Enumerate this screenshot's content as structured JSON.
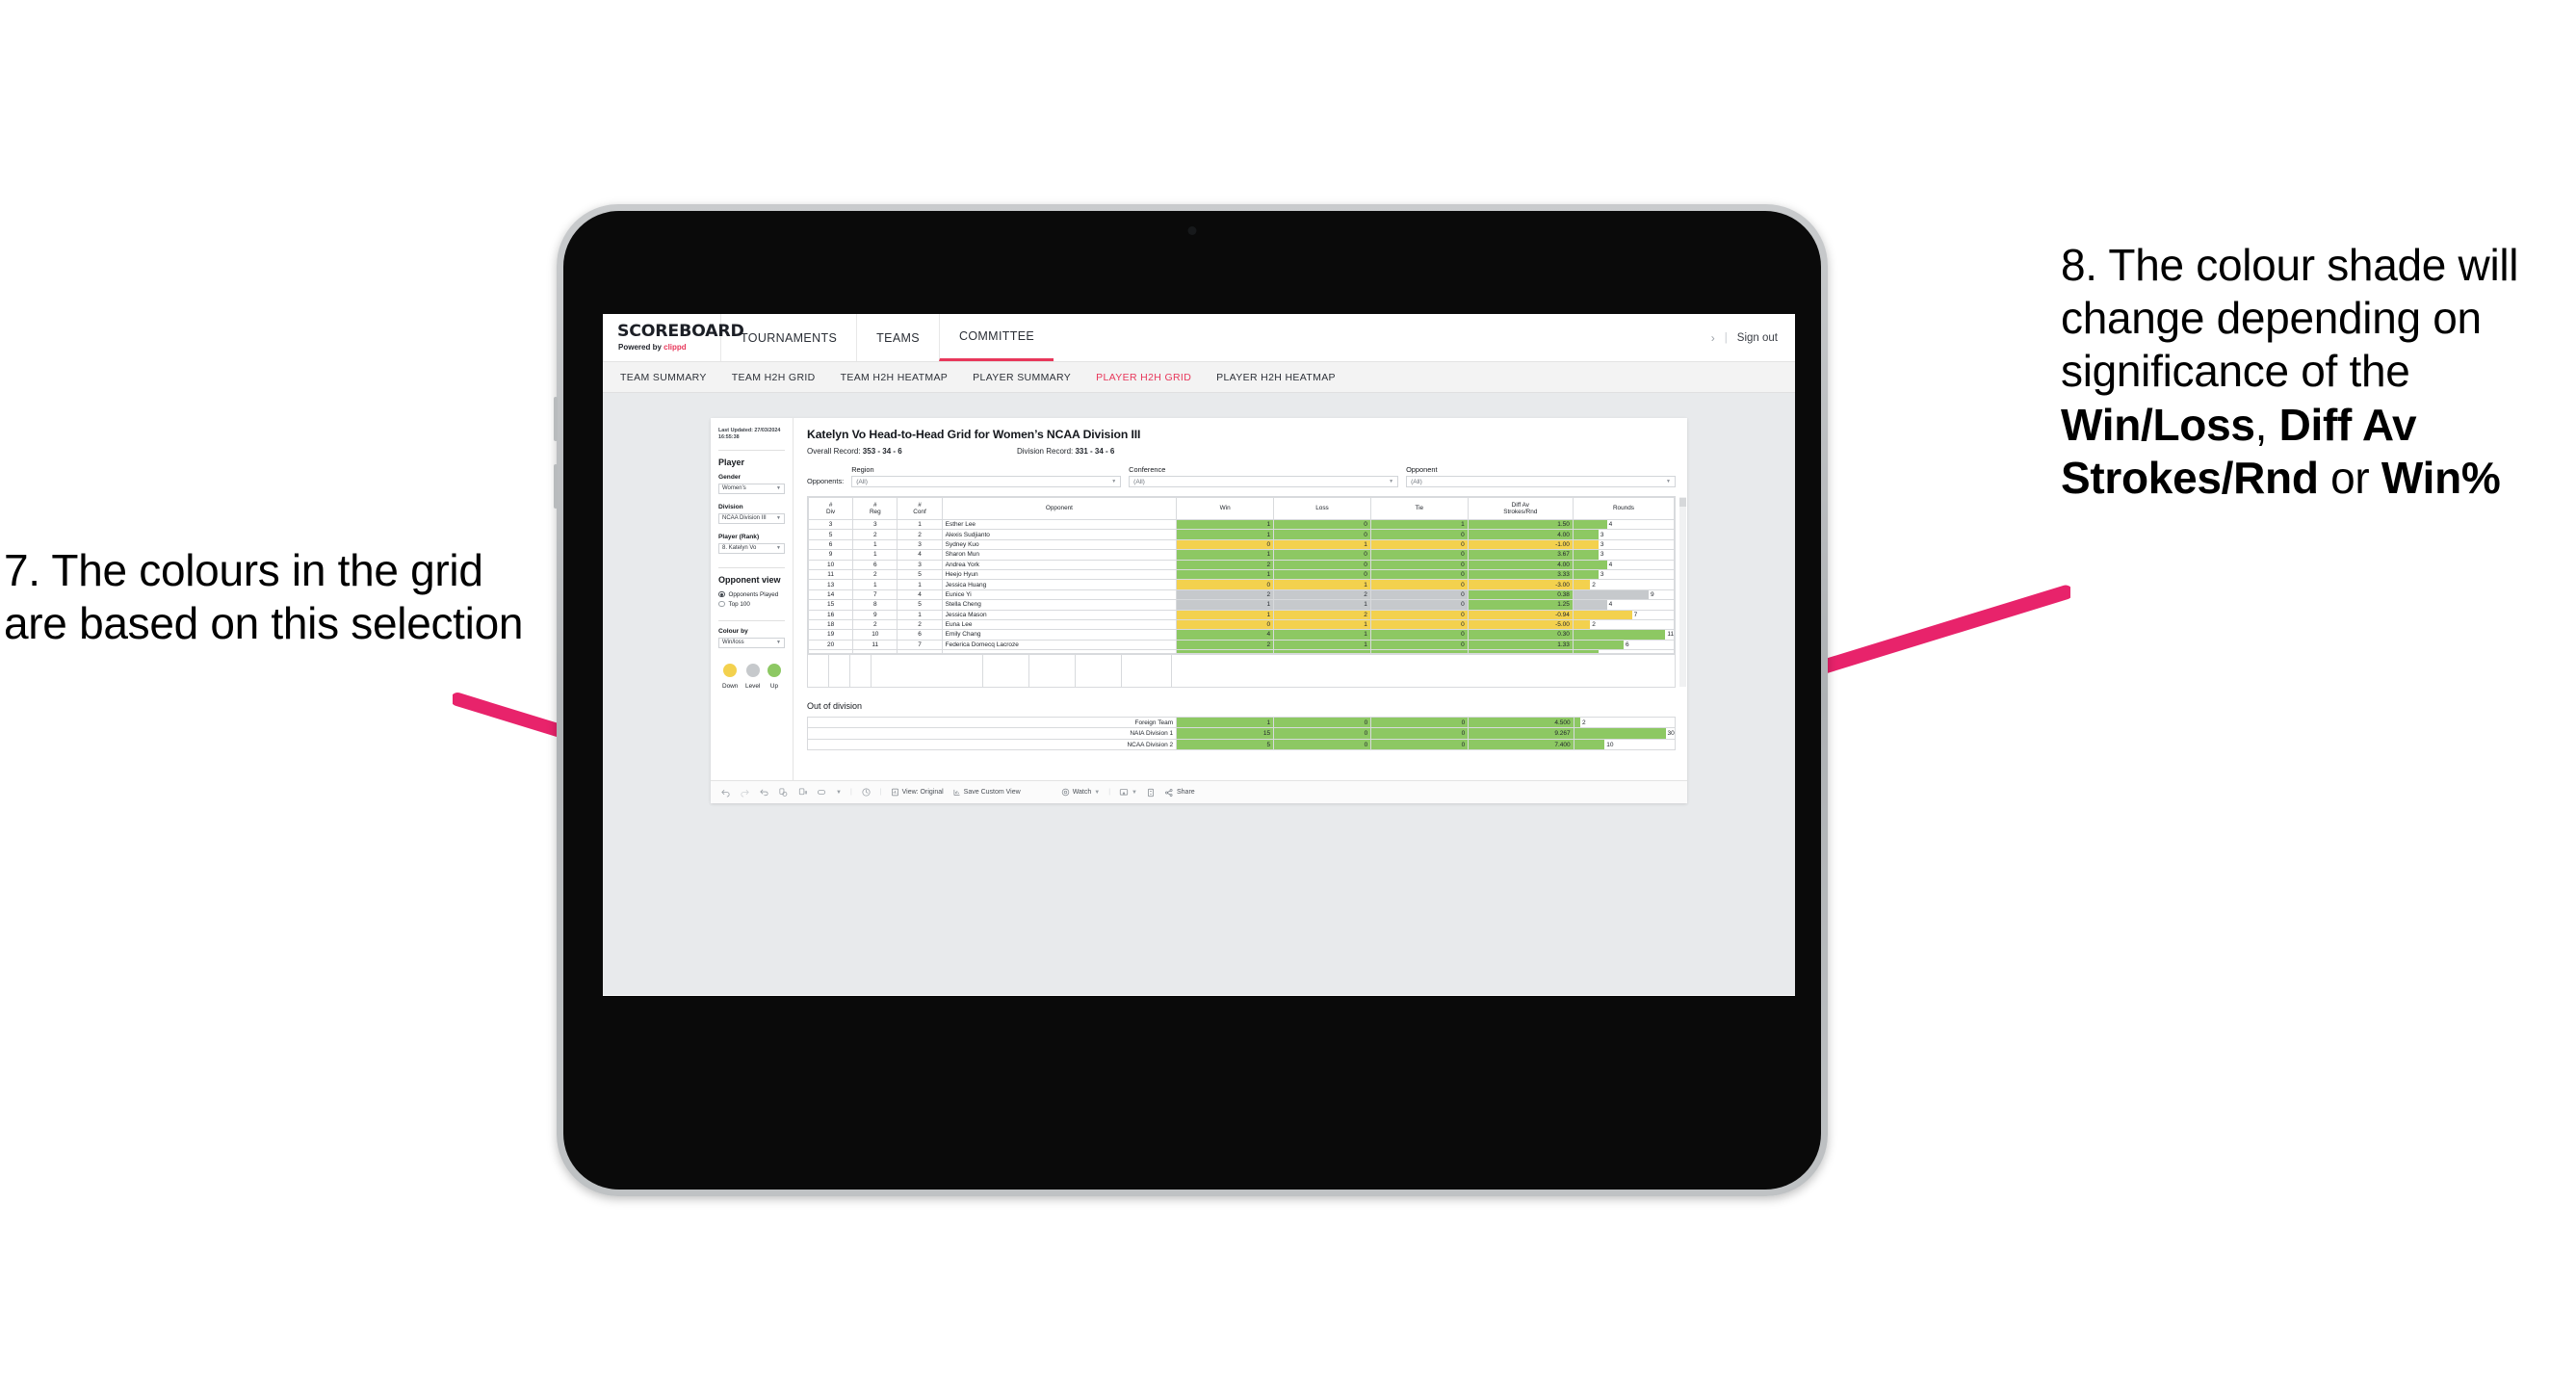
{
  "annotations": {
    "left": "7. The colours in the grid are based on this selection",
    "right_pre": "8. The colour shade will change depending on significance of the ",
    "right_b1": "Win/Loss",
    "right_mid1": ", ",
    "right_b2": "Diff Av Strokes/Rnd",
    "right_mid2": " or ",
    "right_b3": "Win%",
    "arrow_color": "#e8236b"
  },
  "header": {
    "logo_main": "SCOREBOARD",
    "logo_sub_prefix": "Powered by ",
    "logo_sub_brand": "clippd",
    "nav": [
      {
        "label": "TOURNAMENTS",
        "active": false
      },
      {
        "label": "TEAMS",
        "active": false
      },
      {
        "label": "COMMITTEE",
        "active": true
      }
    ],
    "chevron": "›",
    "separator": "|",
    "sign_out": "Sign out"
  },
  "subnav": [
    {
      "label": "TEAM SUMMARY",
      "active": false
    },
    {
      "label": "TEAM H2H GRID",
      "active": false
    },
    {
      "label": "TEAM H2H HEATMAP",
      "active": false
    },
    {
      "label": "PLAYER SUMMARY",
      "active": false
    },
    {
      "label": "PLAYER H2H GRID",
      "active": true
    },
    {
      "label": "PLAYER H2H HEATMAP",
      "active": false
    }
  ],
  "filters": {
    "last_updated": "Last Updated: 27/03/2024 16:55:38",
    "section_title": "Player",
    "gender_label": "Gender",
    "gender_value": "Women’s",
    "division_label": "Division",
    "division_value": "NCAA Division III",
    "player_label": "Player (Rank)",
    "player_value": "8. Katelyn Vo",
    "opponent_view_title": "Opponent view",
    "opponent_view_options": [
      {
        "label": "Opponents Played",
        "selected": true
      },
      {
        "label": "Top 100",
        "selected": false
      }
    ],
    "colour_by_label": "Colour by",
    "colour_by_value": "Win/loss",
    "legend": [
      {
        "label": "Down",
        "color": "#f3d14e"
      },
      {
        "label": "Level",
        "color": "#c6c9cc"
      },
      {
        "label": "Up",
        "color": "#8dc863"
      }
    ]
  },
  "main": {
    "title": "Katelyn Vo Head-to-Head Grid for Women’s NCAA Division III",
    "overall_record_label": "Overall Record: ",
    "overall_record_value": "353 -  34 - 6",
    "division_record_label": "Division Record: ",
    "division_record_value": "331 -  34 - 6",
    "opponents_label": "Opponents:",
    "opponent_filters": [
      {
        "caption": "Region",
        "value": "(All)"
      },
      {
        "caption": "Conference",
        "value": "(All)"
      },
      {
        "caption": "Opponent",
        "value": "(All)"
      }
    ],
    "columns": [
      "# Div",
      "# Reg",
      "# Conf",
      "Opponent",
      "Win",
      "Loss",
      "Tie",
      "Diff Av Strokes/Rnd",
      "Rounds"
    ],
    "column_head_lines": [
      [
        "#",
        "Div"
      ],
      [
        "#",
        "Reg"
      ],
      [
        "#",
        "Conf"
      ],
      [
        "Opponent",
        ""
      ],
      [
        "Win",
        ""
      ],
      [
        "Loss",
        ""
      ],
      [
        "Tie",
        ""
      ],
      [
        "Diff Av",
        "Strokes/Rnd"
      ],
      [
        "Rounds",
        ""
      ]
    ],
    "out_of_division_title": "Out of division"
  },
  "toolbar": {
    "view_label": "View: Original",
    "save_label": "Save Custom View",
    "watch_label": "Watch",
    "share_label": "Share"
  },
  "chart_data": {
    "type": "table",
    "title": "Katelyn Vo Head-to-Head Grid for Women’s NCAA Division III",
    "colors": {
      "up": "#8dc863",
      "down": "#f3d14e",
      "level": "#c6c9cc",
      "none": "#ffffff"
    },
    "rounds_max": 12,
    "columns": [
      "#Div",
      "#Reg",
      "#Conf",
      "Opponent",
      "Win",
      "Loss",
      "Tie",
      "Diff Av Strokes/Rnd",
      "Rounds"
    ],
    "rows": [
      {
        "div": "3",
        "reg": "3",
        "conf": "1",
        "opponent": "Esther Lee",
        "win": "1",
        "loss": "0",
        "tie": "1",
        "diff": "1.50",
        "rounds": "4",
        "rounds_n": 4,
        "color": "up"
      },
      {
        "div": "5",
        "reg": "2",
        "conf": "2",
        "opponent": "Alexis Sudjianto",
        "win": "1",
        "loss": "0",
        "tie": "0",
        "diff": "4.00",
        "rounds": "3",
        "rounds_n": 3,
        "color": "up"
      },
      {
        "div": "6",
        "reg": "1",
        "conf": "3",
        "opponent": "Sydney Kuo",
        "win": "0",
        "loss": "1",
        "tie": "0",
        "diff": "-1.00",
        "rounds": "3",
        "rounds_n": 3,
        "color": "down"
      },
      {
        "div": "9",
        "reg": "1",
        "conf": "4",
        "opponent": "Sharon Mun",
        "win": "1",
        "loss": "0",
        "tie": "0",
        "diff": "3.67",
        "rounds": "3",
        "rounds_n": 3,
        "color": "up"
      },
      {
        "div": "10",
        "reg": "6",
        "conf": "3",
        "opponent": "Andrea York",
        "win": "2",
        "loss": "0",
        "tie": "0",
        "diff": "4.00",
        "rounds": "4",
        "rounds_n": 4,
        "color": "up"
      },
      {
        "div": "11",
        "reg": "2",
        "conf": "5",
        "opponent": "Heejo Hyun",
        "win": "1",
        "loss": "0",
        "tie": "0",
        "diff": "3.33",
        "rounds": "3",
        "rounds_n": 3,
        "color": "up"
      },
      {
        "div": "13",
        "reg": "1",
        "conf": "1",
        "opponent": "Jessica Huang",
        "win": "0",
        "loss": "1",
        "tie": "0",
        "diff": "-3.00",
        "rounds": "2",
        "rounds_n": 2,
        "color": "down"
      },
      {
        "div": "14",
        "reg": "7",
        "conf": "4",
        "opponent": "Eunice Yi",
        "win": "2",
        "loss": "2",
        "tie": "0",
        "diff": "0.38",
        "rounds": "9",
        "rounds_n": 9,
        "color": "level",
        "diff_color": "up"
      },
      {
        "div": "15",
        "reg": "8",
        "conf": "5",
        "opponent": "Stella Cheng",
        "win": "1",
        "loss": "1",
        "tie": "0",
        "diff": "1.25",
        "rounds": "4",
        "rounds_n": 4,
        "color": "level",
        "diff_color": "up"
      },
      {
        "div": "16",
        "reg": "9",
        "conf": "1",
        "opponent": "Jessica Mason",
        "win": "1",
        "loss": "2",
        "tie": "0",
        "diff": "-0.94",
        "rounds": "7",
        "rounds_n": 7,
        "color": "down"
      },
      {
        "div": "18",
        "reg": "2",
        "conf": "2",
        "opponent": "Euna Lee",
        "win": "0",
        "loss": "1",
        "tie": "0",
        "diff": "-5.00",
        "rounds": "2",
        "rounds_n": 2,
        "color": "down"
      },
      {
        "div": "19",
        "reg": "10",
        "conf": "6",
        "opponent": "Emily Chang",
        "win": "4",
        "loss": "1",
        "tie": "0",
        "diff": "0.30",
        "rounds": "11",
        "rounds_n": 11,
        "color": "up"
      },
      {
        "div": "20",
        "reg": "11",
        "conf": "7",
        "opponent": "Federica Domecq Lacroze",
        "win": "2",
        "loss": "1",
        "tie": "0",
        "diff": "1.33",
        "rounds": "6",
        "rounds_n": 6,
        "color": "up"
      }
    ],
    "out_of_division": [
      {
        "name": "Foreign Team",
        "win": "1",
        "loss": "0",
        "tie": "0",
        "diff": "4.500",
        "rounds": "2",
        "rounds_n": 2,
        "color": "up"
      },
      {
        "name": "NAIA Division 1",
        "win": "15",
        "loss": "0",
        "tie": "0",
        "diff": "9.267",
        "rounds": "30",
        "rounds_n": 30,
        "color": "up"
      },
      {
        "name": "NCAA Division 2",
        "win": "5",
        "loss": "0",
        "tie": "0",
        "diff": "7.400",
        "rounds": "10",
        "rounds_n": 10,
        "color": "up"
      }
    ],
    "out_of_division_rounds_max": 33
  }
}
